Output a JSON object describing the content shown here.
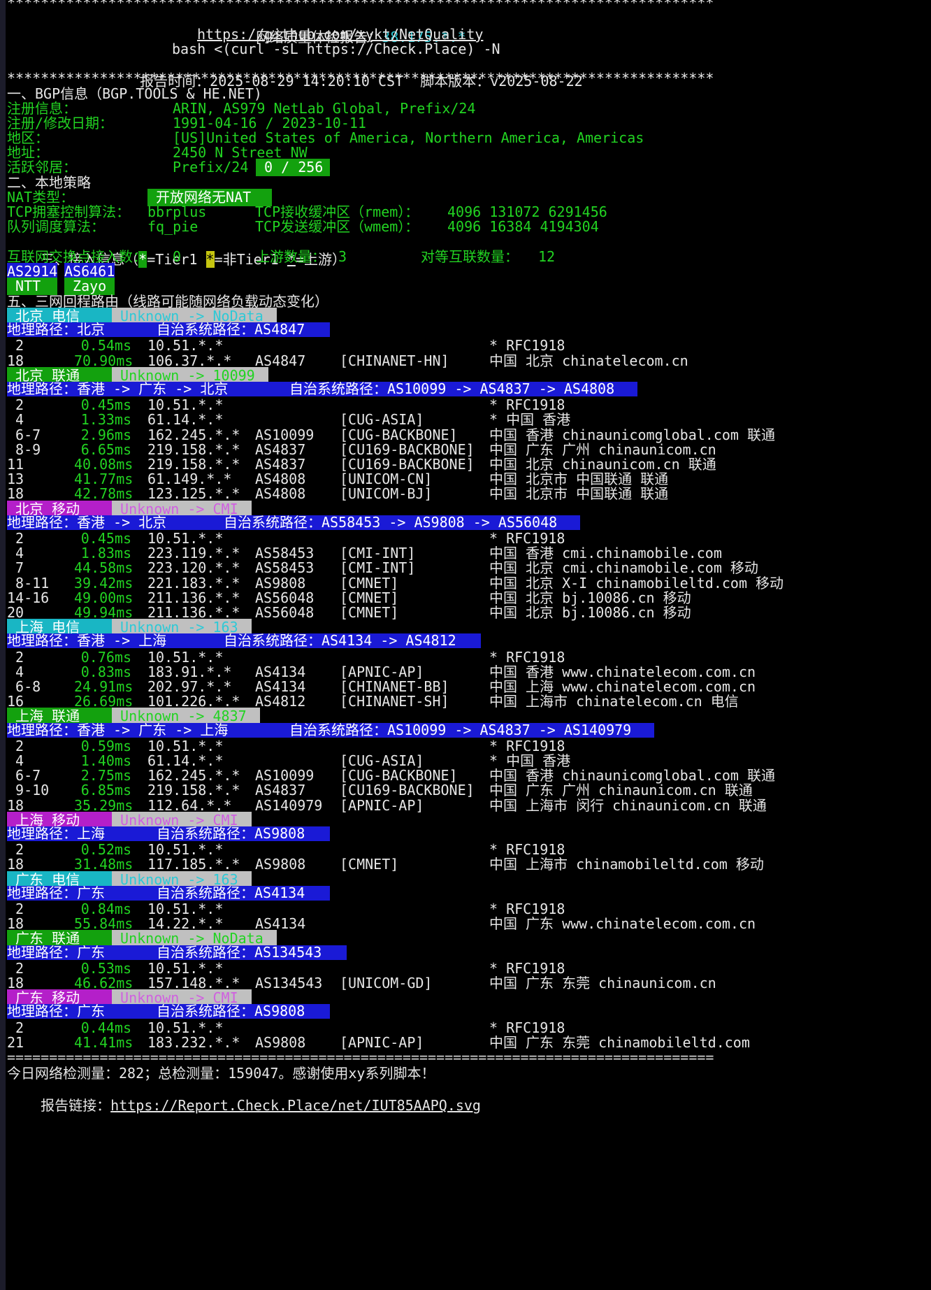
{
  "header": {
    "stars": "************************************************************************************",
    "title_label": "网络质量体检报告：",
    "title_ip": "38.175.*.*",
    "repo_url": "https://github.com/xykt/NetQuality",
    "command": "bash <(curl -sL https://Check.Place) -N",
    "report_time_label": "报告时间：",
    "report_time": "2025-08-29 14:20:10 CST",
    "script_version_label": "脚本版本：",
    "script_version": "v2025-08-22"
  },
  "bgp": {
    "section_title": "一、BGP信息（BGP.TOOLS & HE.NET)",
    "reg_label": "注册信息：",
    "reg_value": "ARIN, AS979 NetLab Global, Prefix/24",
    "date_label": "注册/修改日期：",
    "date_value": "1991-04-16 / 2023-10-11",
    "region_label": "地区：",
    "region_value": "[US]United States of America, Northern America, Americas",
    "address_label": "地址：",
    "address_value": "2450 N Street NW",
    "neighbors_label": "活跃邻居：",
    "neighbors_prefix": "Prefix/24",
    "neighbors_count": " 0 / 256 "
  },
  "local": {
    "section_title": "二、本地策略",
    "nat_label": "NAT类型：",
    "nat_value": " 开放网络无NAT ",
    "tcp_cc_label": "TCP拥塞控制算法：",
    "tcp_cc_value": "bbrplus",
    "rmem_label": "TCP接收缓冲区（rmem）：",
    "rmem_value": "4096 131072 6291456",
    "qdisc_label": "队列调度算法：",
    "qdisc_value": "fq_pie",
    "wmem_label": "TCP发送缓冲区（wmem）：",
    "wmem_value": "4096 16384 4194304"
  },
  "access": {
    "section_title_a": "三、接入信息（",
    "marker": "*",
    "tier1": "=Tier1 ",
    "non_tier1": "=非Tier1 ",
    "upstream": "=上游）",
    "ix_label": "互联网交换点接入数：",
    "ix_value": "0",
    "upstream_label": "上游数量：",
    "upstream_value": "3",
    "peer_label": "对等互联数量：",
    "peer_value": "12",
    "asn": [
      {
        "as": "AS2914",
        "name": " NTT  "
      },
      {
        "as": "AS6461",
        "name": " Zayo  "
      }
    ]
  },
  "routes": {
    "section_title": "五、三网回程路由（线路可能随网络负载动态变化）",
    "path_label": "地理路径：",
    "as_path_label": "自治系统路径：",
    "blocks": [
      {
        "carrier": " 北京 电信 ",
        "carrier_bg": "#19b6c4",
        "tag": " Unknown -> NoData ",
        "tag_color": "#2ec9d6",
        "geo": "北京",
        "aspath": "AS4847",
        "pathbar_w": 462,
        "hops": [
          {
            "n": " 2",
            "ms": "0.54ms",
            "ip": "10.51.*.*",
            "as": "",
            "net": "",
            "loc": "* RFC1918"
          },
          {
            "n": "18",
            "ms": "70.90ms",
            "ip": "106.37.*.*",
            "as": "AS4847",
            "net": "[CHINANET-HN]",
            "loc": "中国 北京 chinatelecom.cn"
          }
        ]
      },
      {
        "carrier": " 北京 联通 ",
        "carrier_bg": "#13a10e",
        "tag": " Unknown -> 10099 ",
        "tag_color": "#22d322",
        "geo": "香港 -> 广东 -> 北京",
        "aspath": "AS10099 -> AS4837 -> AS4808",
        "pathbar_w": 902,
        "hops": [
          {
            "n": " 2",
            "ms": "0.45ms",
            "ip": "10.51.*.*",
            "as": "",
            "net": "",
            "loc": "* RFC1918"
          },
          {
            "n": " 4",
            "ms": "1.33ms",
            "ip": "61.14.*.*",
            "as": "",
            "net": "[CUG-ASIA]",
            "loc": "* 中国 香港"
          },
          {
            "n": " 6-7",
            "ms": "2.96ms",
            "ip": "162.245.*.*",
            "as": "AS10099",
            "net": "[CUG-BACKBONE]",
            "loc": "中国 香港 chinaunicomglobal.com 联通"
          },
          {
            "n": " 8-9",
            "ms": "6.65ms",
            "ip": "219.158.*.*",
            "as": "AS4837",
            "net": "[CU169-BACKBONE]",
            "loc": "中国 广东 广州 chinaunicom.cn"
          },
          {
            "n": "11",
            "ms": "40.08ms",
            "ip": "219.158.*.*",
            "as": "AS4837",
            "net": "[CU169-BACKBONE]",
            "loc": "中国 北京 chinaunicom.cn 联通"
          },
          {
            "n": "13",
            "ms": "41.77ms",
            "ip": "61.149.*.*",
            "as": "AS4808",
            "net": "[UNICOM-CN]",
            "loc": "中国 北京市 中国联通 联通"
          },
          {
            "n": "18",
            "ms": "42.78ms",
            "ip": "123.125.*.*",
            "as": "AS4808",
            "net": "[UNICOM-BJ]",
            "loc": "中国 北京市 中国联通 联通"
          }
        ]
      },
      {
        "carrier": " 北京 移动 ",
        "carrier_bg": "#b41fc9",
        "tag": " Unknown -> CMI ",
        "tag_color": "#d060e0",
        "geo": "香港 -> 北京",
        "aspath": "AS58453 -> AS9808 -> AS56048",
        "pathbar_w": 820,
        "hops": [
          {
            "n": " 2",
            "ms": "0.45ms",
            "ip": "10.51.*.*",
            "as": "",
            "net": "",
            "loc": "* RFC1918"
          },
          {
            "n": " 4",
            "ms": "1.83ms",
            "ip": "223.119.*.*",
            "as": "AS58453",
            "net": "[CMI-INT]",
            "loc": "中国 香港 cmi.chinamobile.com"
          },
          {
            "n": " 7",
            "ms": "44.58ms",
            "ip": "223.120.*.*",
            "as": "AS58453",
            "net": "[CMI-INT]",
            "loc": "中国 北京 cmi.chinamobile.com 移动"
          },
          {
            "n": " 8-11",
            "ms": "39.42ms",
            "ip": "221.183.*.*",
            "as": "AS9808",
            "net": "[CMNET]",
            "loc": "中国 北京 X-I chinamobileltd.com 移动"
          },
          {
            "n": "14-16",
            "ms": "49.00ms",
            "ip": "211.136.*.*",
            "as": "AS56048",
            "net": "[CMNET]",
            "loc": "中国 北京 bj.10086.cn 移动"
          },
          {
            "n": "20",
            "ms": "49.94ms",
            "ip": "211.136.*.*",
            "as": "AS56048",
            "net": "[CMNET]",
            "loc": "中国 北京 bj.10086.cn 移动"
          }
        ]
      },
      {
        "carrier": " 上海 电信 ",
        "carrier_bg": "#19b6c4",
        "tag": " Unknown -> 163 ",
        "tag_color": "#2ec9d6",
        "geo": "香港 -> 上海",
        "aspath": "AS4134 -> AS4812",
        "pathbar_w": 678,
        "hops": [
          {
            "n": " 2",
            "ms": "0.76ms",
            "ip": "10.51.*.*",
            "as": "",
            "net": "",
            "loc": "* RFC1918"
          },
          {
            "n": " 4",
            "ms": "0.83ms",
            "ip": "183.91.*.*",
            "as": "AS4134",
            "net": "[APNIC-AP]",
            "loc": "中国 香港 www.chinatelecom.com.cn"
          },
          {
            "n": " 6-8",
            "ms": "24.91ms",
            "ip": "202.97.*.*",
            "as": "AS4134",
            "net": "[CHINANET-BB]",
            "loc": "中国 上海 www.chinatelecom.com.cn"
          },
          {
            "n": "16",
            "ms": "26.69ms",
            "ip": "101.226.*.*",
            "as": "AS4812",
            "net": "[CHINANET-SH]",
            "loc": "中国 上海市 chinatelecom.cn 电信"
          }
        ]
      },
      {
        "carrier": " 上海 联通 ",
        "carrier_bg": "#13a10e",
        "tag": " Unknown -> 4837 ",
        "tag_color": "#22d322",
        "geo": "香港 -> 广东 -> 上海",
        "aspath": "AS10099 -> AS4837 -> AS140979",
        "pathbar_w": 926,
        "hops": [
          {
            "n": " 2",
            "ms": "0.59ms",
            "ip": "10.51.*.*",
            "as": "",
            "net": "",
            "loc": "* RFC1918"
          },
          {
            "n": " 4",
            "ms": "1.40ms",
            "ip": "61.14.*.*",
            "as": "",
            "net": "[CUG-ASIA]",
            "loc": "* 中国 香港"
          },
          {
            "n": " 6-7",
            "ms": "2.75ms",
            "ip": "162.245.*.*",
            "as": "AS10099",
            "net": "[CUG-BACKBONE]",
            "loc": "中国 香港 chinaunicomglobal.com 联通"
          },
          {
            "n": " 9-10",
            "ms": "6.85ms",
            "ip": "219.158.*.*",
            "as": "AS4837",
            "net": "[CU169-BACKBONE]",
            "loc": "中国 广东 广州 chinaunicom.cn 联通"
          },
          {
            "n": "18",
            "ms": "35.29ms",
            "ip": "112.64.*.*",
            "as": "AS140979",
            "net": "[APNIC-AP]",
            "loc": "中国 上海市 闵行 chinaunicom.cn 联通"
          }
        ]
      },
      {
        "carrier": " 上海 移动 ",
        "carrier_bg": "#b41fc9",
        "tag": " Unknown -> CMI ",
        "tag_color": "#d060e0",
        "geo": "上海",
        "aspath": "AS9808",
        "pathbar_w": 462,
        "hops": [
          {
            "n": " 2",
            "ms": "0.52ms",
            "ip": "10.51.*.*",
            "as": "",
            "net": "",
            "loc": "* RFC1918"
          },
          {
            "n": "18",
            "ms": "31.48ms",
            "ip": "117.185.*.*",
            "as": "AS9808",
            "net": "[CMNET]",
            "loc": "中国 上海市 chinamobileltd.com 移动"
          }
        ]
      },
      {
        "carrier": " 广东 电信 ",
        "carrier_bg": "#19b6c4",
        "tag": " Unknown -> 163 ",
        "tag_color": "#2ec9d6",
        "geo": "广东",
        "aspath": "AS4134",
        "pathbar_w": 462,
        "hops": [
          {
            "n": " 2",
            "ms": "0.84ms",
            "ip": "10.51.*.*",
            "as": "",
            "net": "",
            "loc": "* RFC1918"
          },
          {
            "n": "18",
            "ms": "55.84ms",
            "ip": "14.22.*.*",
            "as": "AS4134",
            "net": "",
            "loc": "中国 广东 www.chinatelecom.com.cn"
          }
        ]
      },
      {
        "carrier": " 广东 联通 ",
        "carrier_bg": "#13a10e",
        "tag": " Unknown -> NoData ",
        "tag_color": "#22d322",
        "geo": "广东",
        "aspath": "AS134543",
        "pathbar_w": 486,
        "hops": [
          {
            "n": " 2",
            "ms": "0.53ms",
            "ip": "10.51.*.*",
            "as": "",
            "net": "",
            "loc": "* RFC1918"
          },
          {
            "n": "18",
            "ms": "46.62ms",
            "ip": "157.148.*.*",
            "as": "AS134543",
            "net": "[UNICOM-GD]",
            "loc": "中国 广东 东莞 chinaunicom.cn"
          }
        ]
      },
      {
        "carrier": " 广东 移动 ",
        "carrier_bg": "#b41fc9",
        "tag": " Unknown -> CMI ",
        "tag_color": "#d060e0",
        "geo": "广东",
        "aspath": "AS9808",
        "pathbar_w": 462,
        "hops": [
          {
            "n": " 2",
            "ms": "0.44ms",
            "ip": "10.51.*.*",
            "as": "",
            "net": "",
            "loc": "* RFC1918"
          },
          {
            "n": "21",
            "ms": "41.41ms",
            "ip": "183.232.*.*",
            "as": "AS9808",
            "net": "[APNIC-AP]",
            "loc": "中国 广东 东莞 chinamobileltd.com"
          }
        ]
      }
    ]
  },
  "footer": {
    "divider": "====================================================================================",
    "stats": "今日网络检测量：282；总检测量：159047。感谢使用xy系列脚本！",
    "report_label": "报告链接：",
    "report_url": "https://Report.Check.Place/net/IUT85AAPQ.svg"
  }
}
